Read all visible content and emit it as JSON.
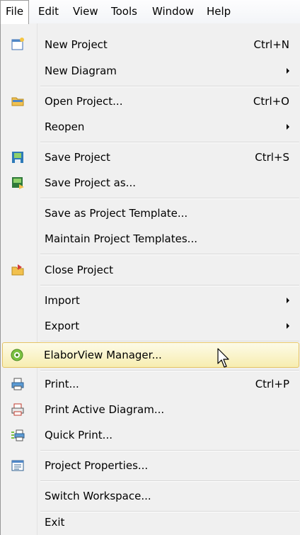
{
  "menubar": {
    "items": [
      {
        "label": "File",
        "active": true
      },
      {
        "label": "Edit"
      },
      {
        "label": "View"
      },
      {
        "label": "Tools"
      },
      {
        "label": "Window"
      },
      {
        "label": "Help"
      }
    ]
  },
  "file_menu": {
    "items": [
      {
        "label": "New Project",
        "shortcut": "Ctrl+N",
        "icon": "new-project-icon"
      },
      {
        "label": "New Diagram",
        "submenu": true
      },
      {
        "label": "Open Project...",
        "shortcut": "Ctrl+O",
        "icon": "folder-open-icon"
      },
      {
        "label": "Reopen",
        "submenu": true
      },
      {
        "label": "Save Project",
        "shortcut": "Ctrl+S",
        "icon": "save-icon"
      },
      {
        "label": "Save Project as...",
        "icon": "save-as-icon"
      },
      {
        "label": "Save as Project Template..."
      },
      {
        "label": "Maintain Project Templates..."
      },
      {
        "label": "Close Project",
        "icon": "close-project-icon"
      },
      {
        "label": "Import",
        "submenu": true
      },
      {
        "label": "Export",
        "submenu": true
      },
      {
        "label": "ElaborView Manager...",
        "icon": "elaborview-icon",
        "highlighted": true
      },
      {
        "label": "Print...",
        "shortcut": "Ctrl+P",
        "icon": "printer-icon"
      },
      {
        "label": "Print Active Diagram...",
        "icon": "print-diagram-icon"
      },
      {
        "label": "Quick Print...",
        "icon": "quick-print-icon"
      },
      {
        "label": "Project Properties...",
        "icon": "properties-icon"
      },
      {
        "label": "Switch Workspace..."
      },
      {
        "label": "Exit"
      }
    ]
  },
  "colors": {
    "highlight_border": "#e5c365",
    "highlight_fill": "#f7edb0",
    "menu_background": "#f0f0f0"
  }
}
